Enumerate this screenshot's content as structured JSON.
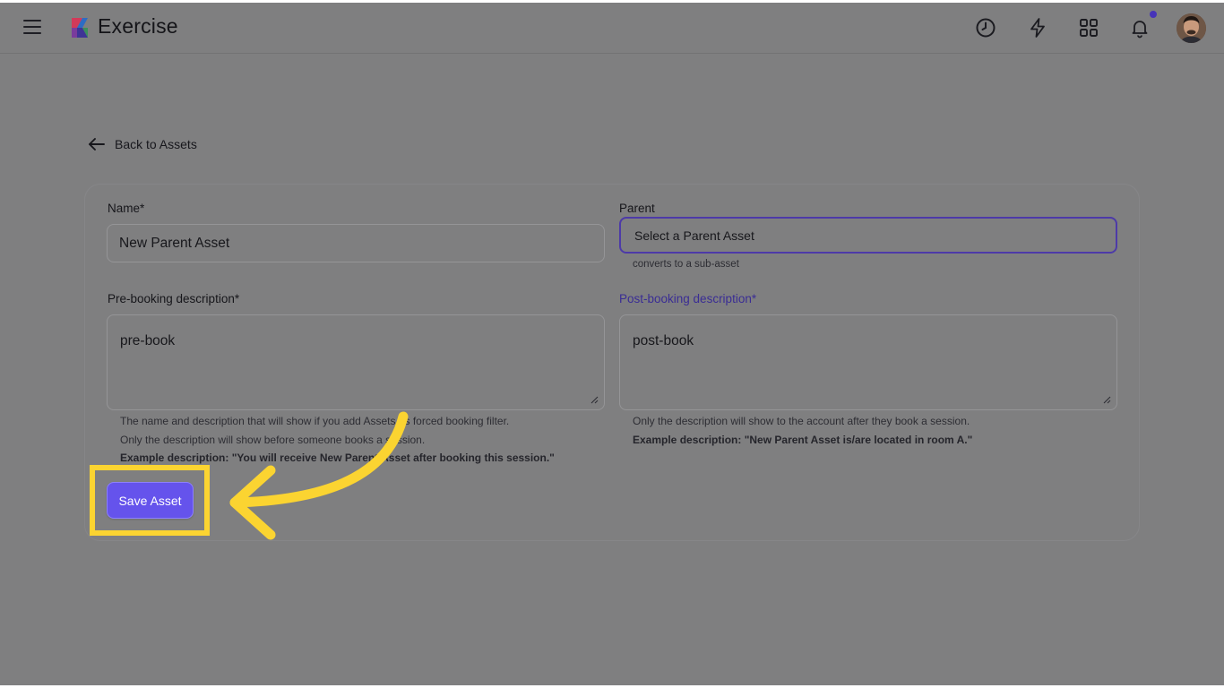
{
  "app": {
    "title": "Exercise"
  },
  "header": {
    "icons": [
      "clock-icon",
      "lightning-icon",
      "apps-grid-icon",
      "bell-icon"
    ],
    "accent_dot_color": "#4633b8"
  },
  "nav": {
    "back_label": "Back to Assets"
  },
  "form": {
    "name": {
      "label": "Name*",
      "value": "New Parent Asset"
    },
    "parent": {
      "label": "Parent",
      "value": "Select a Parent Asset",
      "hint": "converts to a sub-asset"
    },
    "pre_booking": {
      "label": "Pre-booking description*",
      "value": "pre-book",
      "hint_line1": "The name and description that will show if you add Assets as forced booking filter.",
      "hint_line2": "Only the description will show before someone books a session.",
      "hint_example": "Example description: \"You will receive New Parent Asset after booking this session.\""
    },
    "post_booking": {
      "label": "Post-booking description*",
      "value": "post-book",
      "hint_line1": "Only the description will show to the account after they book a session.",
      "hint_example": "Example description: \"New Parent Asset is/are located in room A.\""
    },
    "save_label": "Save Asset"
  },
  "colors": {
    "primary_button": "#6553ec",
    "focus_border": "#4d3aa8",
    "annotation_highlight": "#fbd431"
  }
}
